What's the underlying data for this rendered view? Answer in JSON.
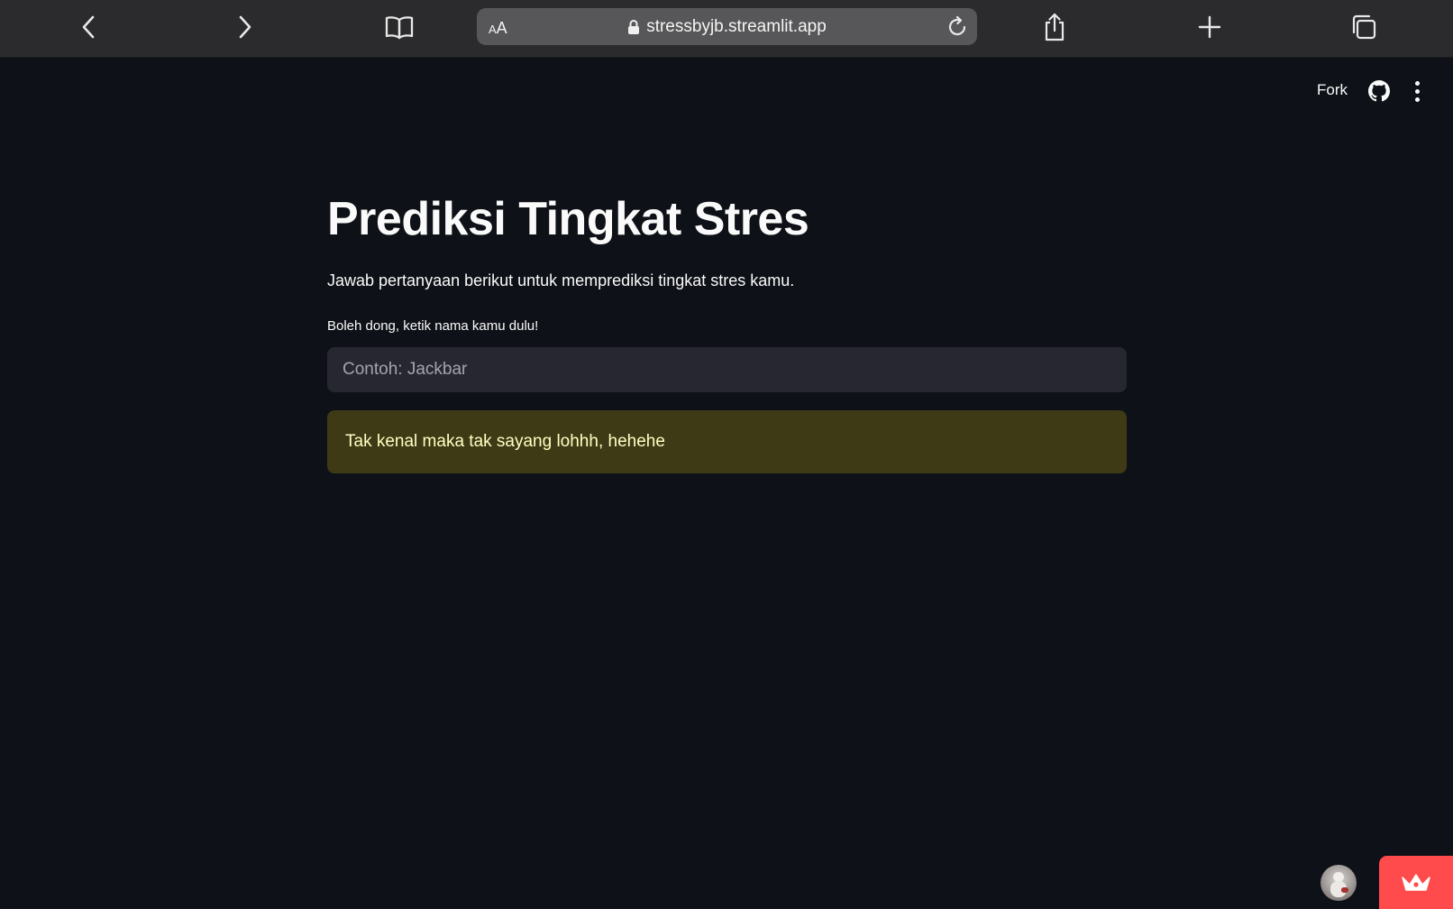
{
  "browser": {
    "text_size_label_small": "A",
    "text_size_label_large": "A",
    "url": "stressbyjb.streamlit.app",
    "icons": {
      "back": "chevron-left-icon",
      "forward": "chevron-right-icon",
      "bookmarks": "book-icon",
      "lock": "lock-icon",
      "reload": "reload-icon",
      "share": "share-icon",
      "new_tab": "plus-icon",
      "tabs": "tabs-icon"
    }
  },
  "header": {
    "fork_label": "Fork",
    "github_icon": "github-icon",
    "menu_icon": "more-vertical-icon"
  },
  "main": {
    "title": "Prediksi Tingkat Stres",
    "subtitle": "Jawab pertanyaan berikut untuk memprediksi tingkat stres kamu.",
    "name_label": "Boleh dong, ketik nama kamu dulu!",
    "name_value": "",
    "name_placeholder": "Contoh: Jackbar",
    "warning": "Tak kenal maka tak sayang lohhh, hehehe"
  },
  "footer": {
    "avatar_icon": "user-avatar",
    "badge_icon": "crown-icon"
  },
  "colors": {
    "background": "#0e1117",
    "browser_bar": "#2b2b2d",
    "input_bg": "#262730",
    "warning_bg": "#3e3a16",
    "warning_text": "#ffffc2",
    "accent": "#ff4b4b"
  }
}
